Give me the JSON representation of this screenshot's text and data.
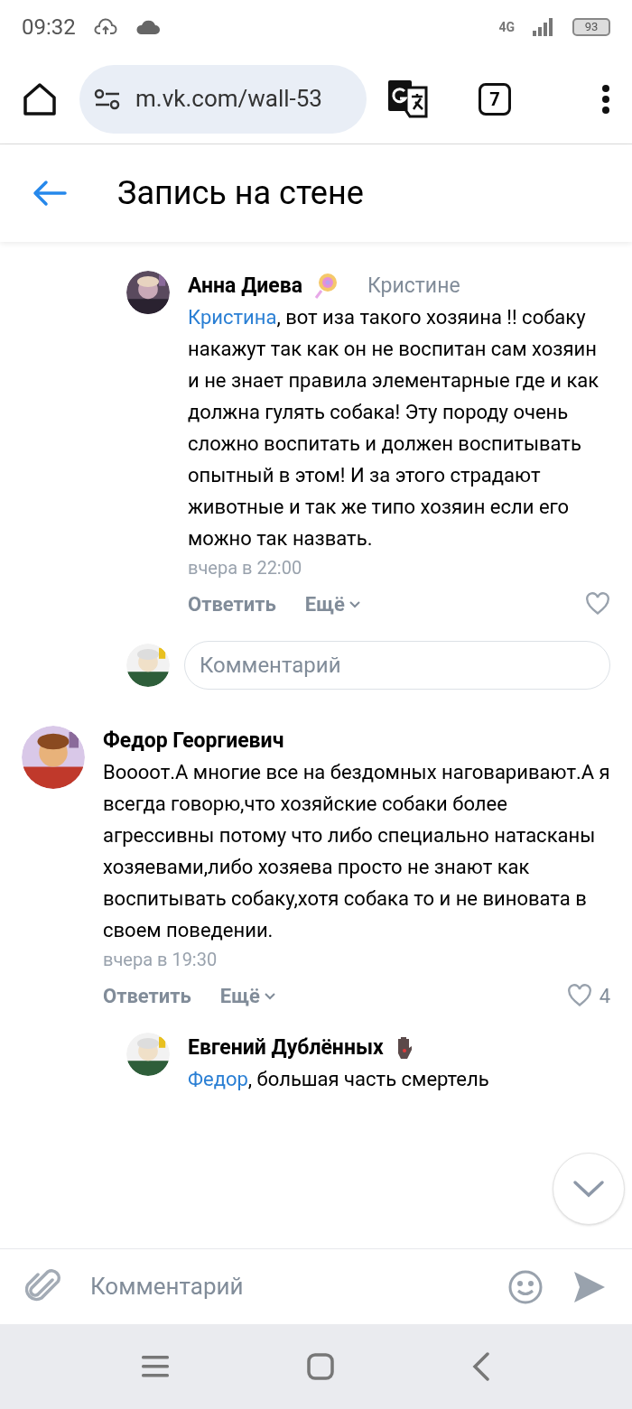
{
  "status_bar": {
    "time": "09:32",
    "network": "4G",
    "battery": "93"
  },
  "browser": {
    "url": "m.vk.com/wall-53",
    "tab_count": "7"
  },
  "header": {
    "title": "Запись на стене"
  },
  "comments": [
    {
      "kind": "reply",
      "author": "Анна Диева",
      "reply_to": "Кристине",
      "mention": "Кристина",
      "text": ", вот иза такого хозяина !! собаку накажут так как он не воспитан сам хозяин и не знает правила элементарные где и как должна гулять собака! Эту породу очень сложно воспитать и должен воспитывать опытный в этом! И за этого страдают животные и так же типо хозяин если его можно так назвать.",
      "time": "вчера в 22:00",
      "reply_label": "Ответить",
      "more_label": "Ещё"
    },
    {
      "kind": "composer",
      "placeholder": "Комментарий"
    },
    {
      "kind": "comment",
      "author": "Федор Георгиевич",
      "text": "Воооот.А многие все на бездомных наговаривают.А я всегда говорю,что хозяйские собаки более агрессивны потому что либо специально натасканы хозяевами,либо хозяева просто не знают как воспитывать собаку,хотя собака то и не виновата в своем поведении.",
      "time": "вчера в 19:30",
      "reply_label": "Ответить",
      "more_label": "Ещё",
      "likes": "4"
    },
    {
      "kind": "reply",
      "author": "Евгений Дублённых",
      "mention": "Федор",
      "text": ", большая часть смертель"
    }
  ],
  "comment_bar": {
    "placeholder": "Комментарий"
  }
}
